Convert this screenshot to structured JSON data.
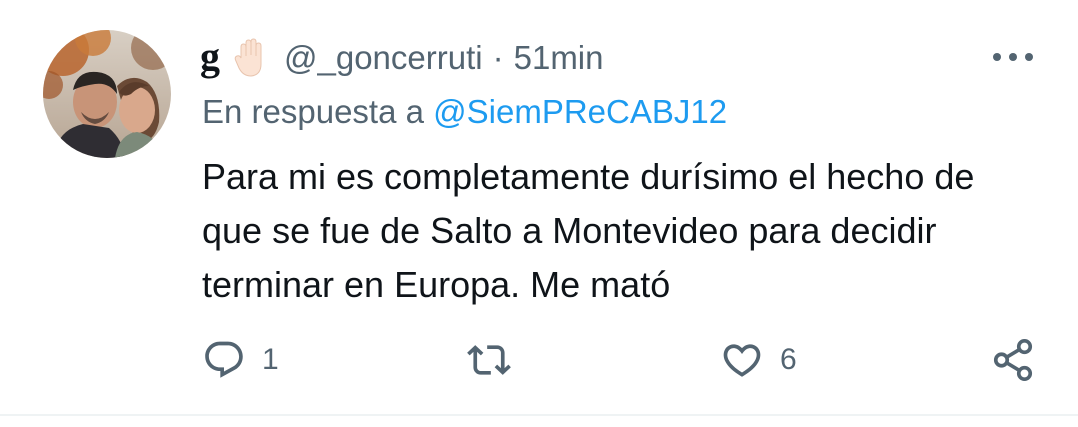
{
  "tweet": {
    "author": {
      "display_name": "g",
      "name_emoji": "raised-hand-emoji",
      "handle": "@_goncerruti",
      "avatar_icon": "avatar-photo"
    },
    "separator": "·",
    "time": "51min",
    "reply": {
      "prefix": "En respuesta a",
      "target": "@SiemPReCABJ12"
    },
    "text": "Para mi es completamente durísimo el hecho de que se fue de Salto a Montevideo para decidir terminar en Europa. Me mató",
    "actions": {
      "reply_count": "1",
      "retweet_count": "",
      "like_count": "6"
    },
    "icons": {
      "more": "more-horizontal-icon",
      "reply": "reply-icon",
      "retweet": "retweet-icon",
      "like": "heart-icon",
      "share": "share-icon"
    },
    "colors": {
      "link": "#1d9bf0",
      "secondary_text": "#536471",
      "primary_text": "#0f1419",
      "divider": "#eff3f4"
    }
  }
}
